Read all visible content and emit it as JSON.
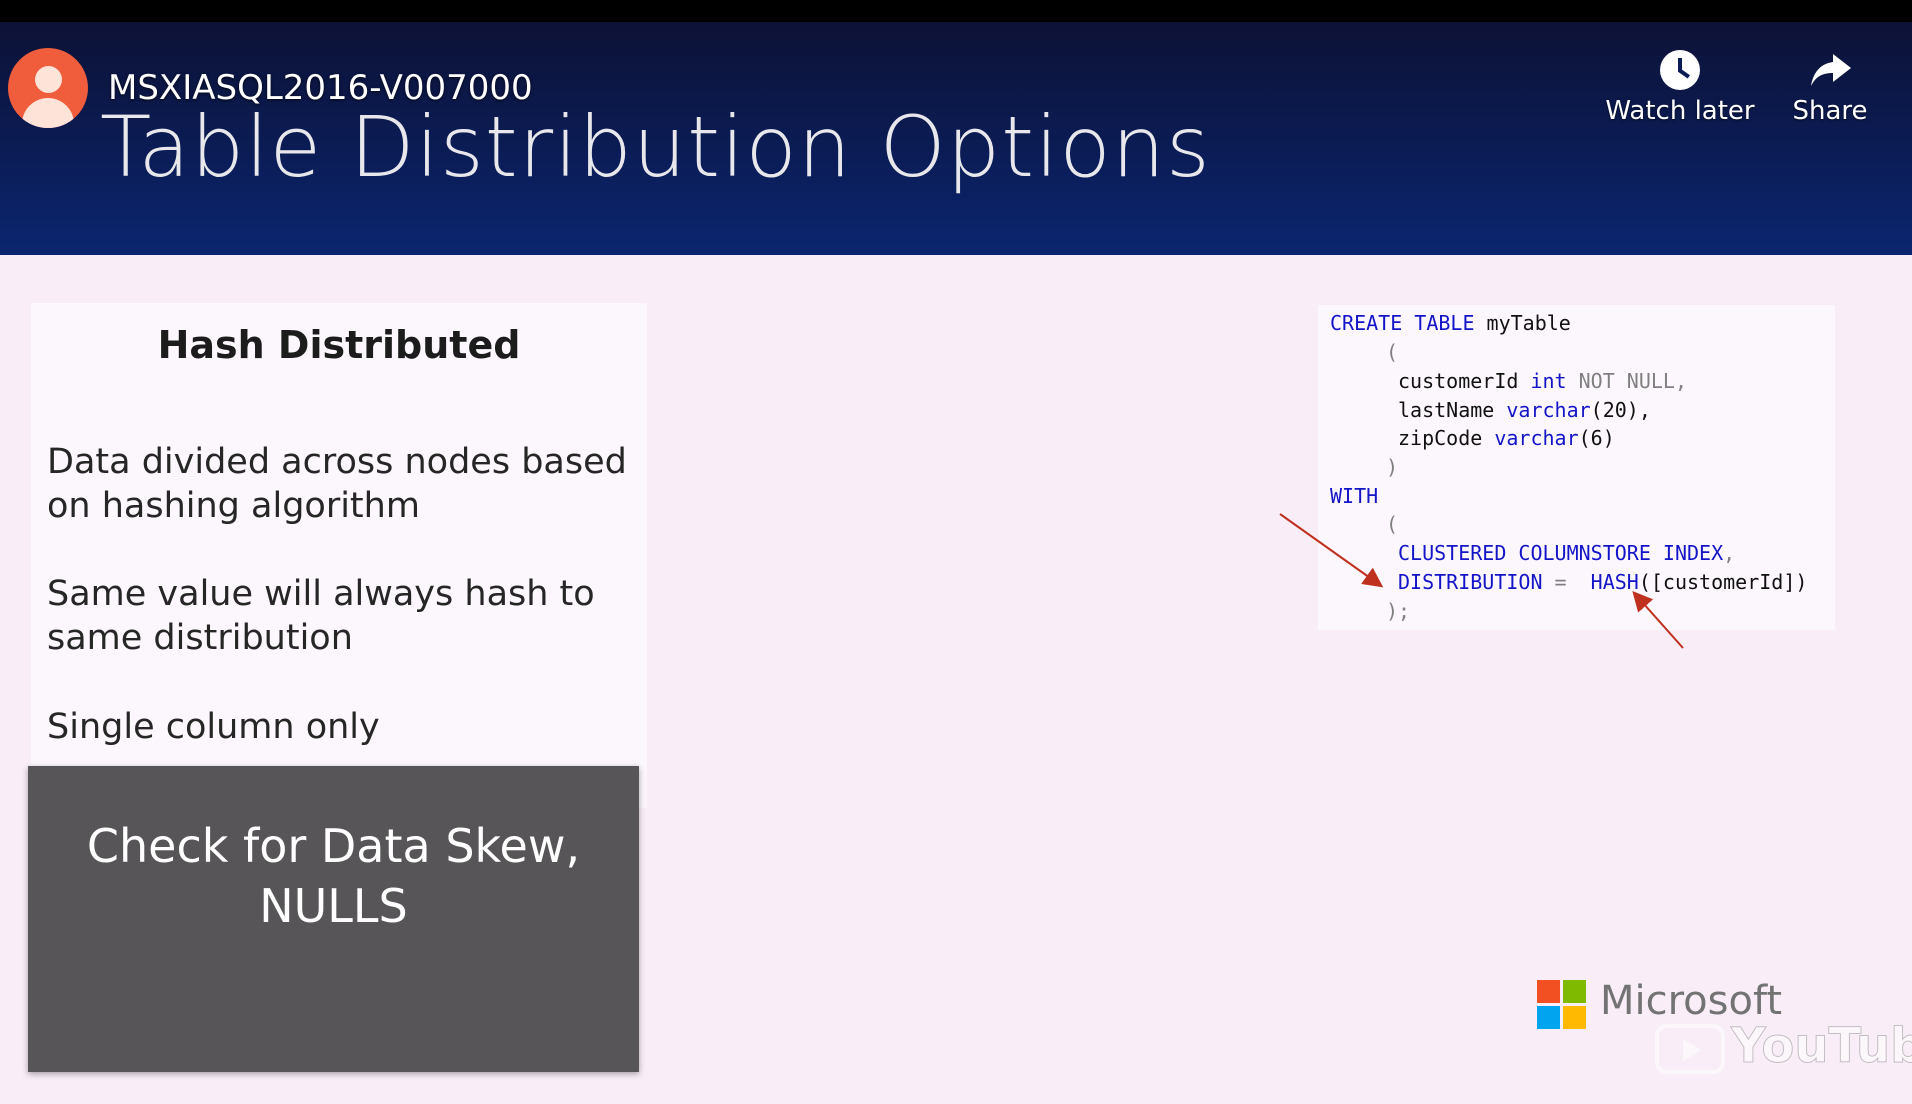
{
  "player": {
    "video_title": "MSXIASQL2016-V007000",
    "watch_later_label": "Watch later",
    "share_label": "Share"
  },
  "slide": {
    "title": "Table Distribution Options",
    "card": {
      "heading": "Hash Distributed",
      "bullets": [
        "Data divided across nodes based on hashing algorithm",
        "Same value will always hash to same distribution",
        "Single column only"
      ]
    },
    "callout": "Check for Data Skew, NULLS",
    "code": {
      "l1_kw": "CREATE TABLE",
      "l1_name": " myTable",
      "l2": "(",
      "l3_name": "customerId ",
      "l3_type": "int",
      "l3_rest": " NOT NULL,",
      "l4_name": "lastName ",
      "l4_type": "varchar",
      "l4_rest": "(20),",
      "l5_name": "zipCode ",
      "l5_type": "varchar",
      "l5_rest": "(6)",
      "l6": ")",
      "l7_kw": "WITH",
      "l8": "(",
      "l9_kw": "CLUSTERED COLUMNSTORE INDEX",
      "l9_rest": ",",
      "l10_kw": "DISTRIBUTION",
      "l10_eq": " =  ",
      "l10_hash": "HASH",
      "l10_rest": "([customerId])",
      "l11": ");"
    },
    "brand": "Microsoft",
    "watermark": "YouTube"
  },
  "colors": {
    "header_bg": "#0b1c55",
    "slide_bg": "#f9eef8",
    "callout_bg": "#575557",
    "keyword_blue": "#1414c8",
    "arrow_red": "#c0301f"
  },
  "icons": {
    "avatar": "avatar-icon",
    "watch_later": "clock-icon",
    "share": "share-arrow-icon",
    "logo": "microsoft-logo-icon",
    "watermark": "youtube-logo-icon"
  }
}
